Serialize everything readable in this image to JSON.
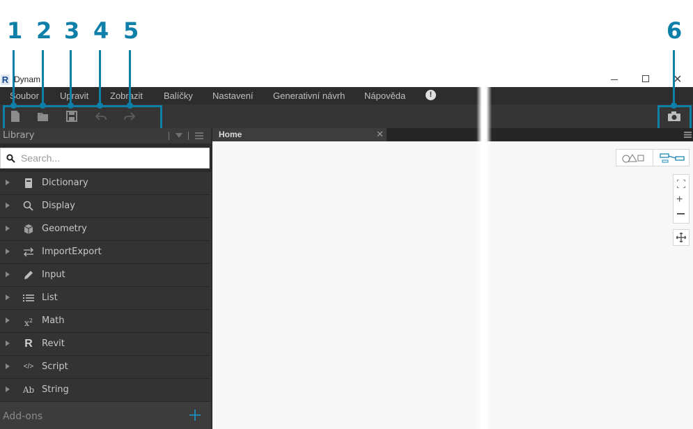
{
  "callouts": [
    "1",
    "2",
    "3",
    "4",
    "5",
    "6"
  ],
  "window": {
    "title": "Dynam"
  },
  "menu": {
    "items": [
      "Soubor",
      "Upravit",
      "Zobrazit",
      "Balíčky",
      "Nastavení",
      "Generativní návrh",
      "Nápověda"
    ]
  },
  "library": {
    "header": "Library",
    "search_placeholder": "Search...",
    "items": [
      {
        "label": "Dictionary",
        "icon": "book-icon"
      },
      {
        "label": "Display",
        "icon": "magnifier-icon"
      },
      {
        "label": "Geometry",
        "icon": "cube-icon"
      },
      {
        "label": "ImportExport",
        "icon": "swap-arrows-icon"
      },
      {
        "label": "Input",
        "icon": "pencil-icon"
      },
      {
        "label": "List",
        "icon": "list-icon"
      },
      {
        "label": "Math",
        "icon": "x-squared-icon"
      },
      {
        "label": "Revit",
        "icon": "revit-r-icon"
      },
      {
        "label": "Script",
        "icon": "code-icon"
      },
      {
        "label": "String",
        "icon": "ab-text-icon"
      }
    ],
    "math_glyph": "x",
    "math_sup": "2",
    "revit_glyph": "R",
    "script_glyph": "</>",
    "string_glyph": "Ab",
    "addons_label": "Add-ons"
  },
  "tabs": [
    {
      "label": "Home"
    }
  ],
  "colors": {
    "accent": "#0e7fa8",
    "menubar": "#2d2d2d",
    "toolbar": "#353535",
    "canvas": "#f7f7f7"
  }
}
